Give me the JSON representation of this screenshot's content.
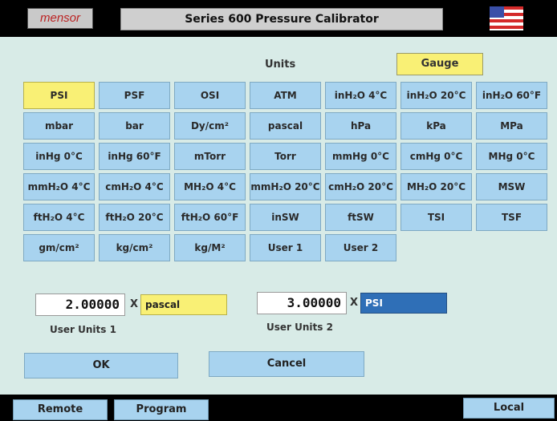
{
  "header": {
    "logo": "mensor",
    "title": "Series 600 Pressure Calibrator"
  },
  "units": {
    "label": "Units",
    "mode": "Gauge",
    "selected": "PSI",
    "rows": [
      [
        "PSI",
        "PSF",
        "OSI",
        "ATM",
        "inH₂O 4°C",
        "inH₂O 20°C",
        "inH₂O 60°F"
      ],
      [
        "mbar",
        "bar",
        "Dy/cm²",
        "pascal",
        "hPa",
        "kPa",
        "MPa"
      ],
      [
        "inHg 0°C",
        "inHg 60°F",
        "mTorr",
        "Torr",
        "mmHg 0°C",
        "cmHg 0°C",
        "MHg 0°C"
      ],
      [
        "mmH₂O 4°C",
        "cmH₂O 4°C",
        "MH₂O 4°C",
        "mmH₂O 20°C",
        "cmH₂O 20°C",
        "MH₂O 20°C",
        "MSW"
      ],
      [
        "ftH₂O 4°C",
        "ftH₂O 20°C",
        "ftH₂O 60°F",
        "inSW",
        "ftSW",
        "TSI",
        "TSF"
      ],
      [
        "gm/cm²",
        "kg/cm²",
        "kg/M²",
        "User 1",
        "User 2"
      ]
    ]
  },
  "user_units": [
    {
      "value": "2.00000",
      "x": "X",
      "unit": "pascal",
      "label": "User Units 1"
    },
    {
      "value": "3.00000",
      "x": "X",
      "unit": "PSI",
      "label": "User Units 2"
    }
  ],
  "buttons": {
    "ok": "OK",
    "cancel": "Cancel"
  },
  "footer": {
    "remote": "Remote",
    "program": "Program",
    "local": "Local"
  },
  "colors": {
    "background": "#d8ebe7",
    "button": "#a8d3ef",
    "selected": "#f9f075",
    "active_unit": "#2f6fb7"
  }
}
